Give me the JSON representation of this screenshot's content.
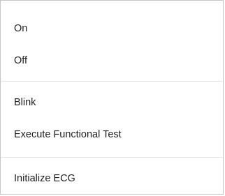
{
  "menu": {
    "items": [
      {
        "label": "On"
      },
      {
        "label": "Off"
      },
      {
        "label": "Blink"
      },
      {
        "label": "Execute Functional Test"
      },
      {
        "label": "Initialize ECG"
      }
    ]
  },
  "colors": {
    "background": "#ffffff",
    "border": "#c7c7c7",
    "separator": "#e1e1e1",
    "text": "#1f1f1f"
  }
}
